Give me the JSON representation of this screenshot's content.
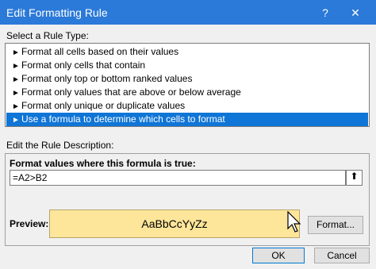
{
  "window": {
    "title": "Edit Formatting Rule",
    "help_glyph": "?",
    "close_glyph": "✕"
  },
  "rule_type": {
    "label": "Select a Rule Type:",
    "items": [
      {
        "label": "Format all cells based on their values"
      },
      {
        "label": "Format only cells that contain"
      },
      {
        "label": "Format only top or bottom ranked values"
      },
      {
        "label": "Format only values that are above or below average"
      },
      {
        "label": "Format only unique or duplicate values"
      },
      {
        "label": "Use a formula to determine which cells to format"
      }
    ],
    "selected_index": 5,
    "arrow_glyph": "►"
  },
  "description": {
    "label": "Edit the Rule Description:",
    "formula_label": "Format values where this formula is true:",
    "formula_value": "=A2>B2",
    "collapse_glyph": "⬆",
    "preview_label": "Preview:",
    "preview_text": "AaBbCcYyZz",
    "preview_fill_color": "#fde59a",
    "format_button": "Format..."
  },
  "buttons": {
    "ok": "OK",
    "cancel": "Cancel"
  },
  "colors": {
    "titlebar": "#2b79d8",
    "selection": "#0f75d6"
  }
}
